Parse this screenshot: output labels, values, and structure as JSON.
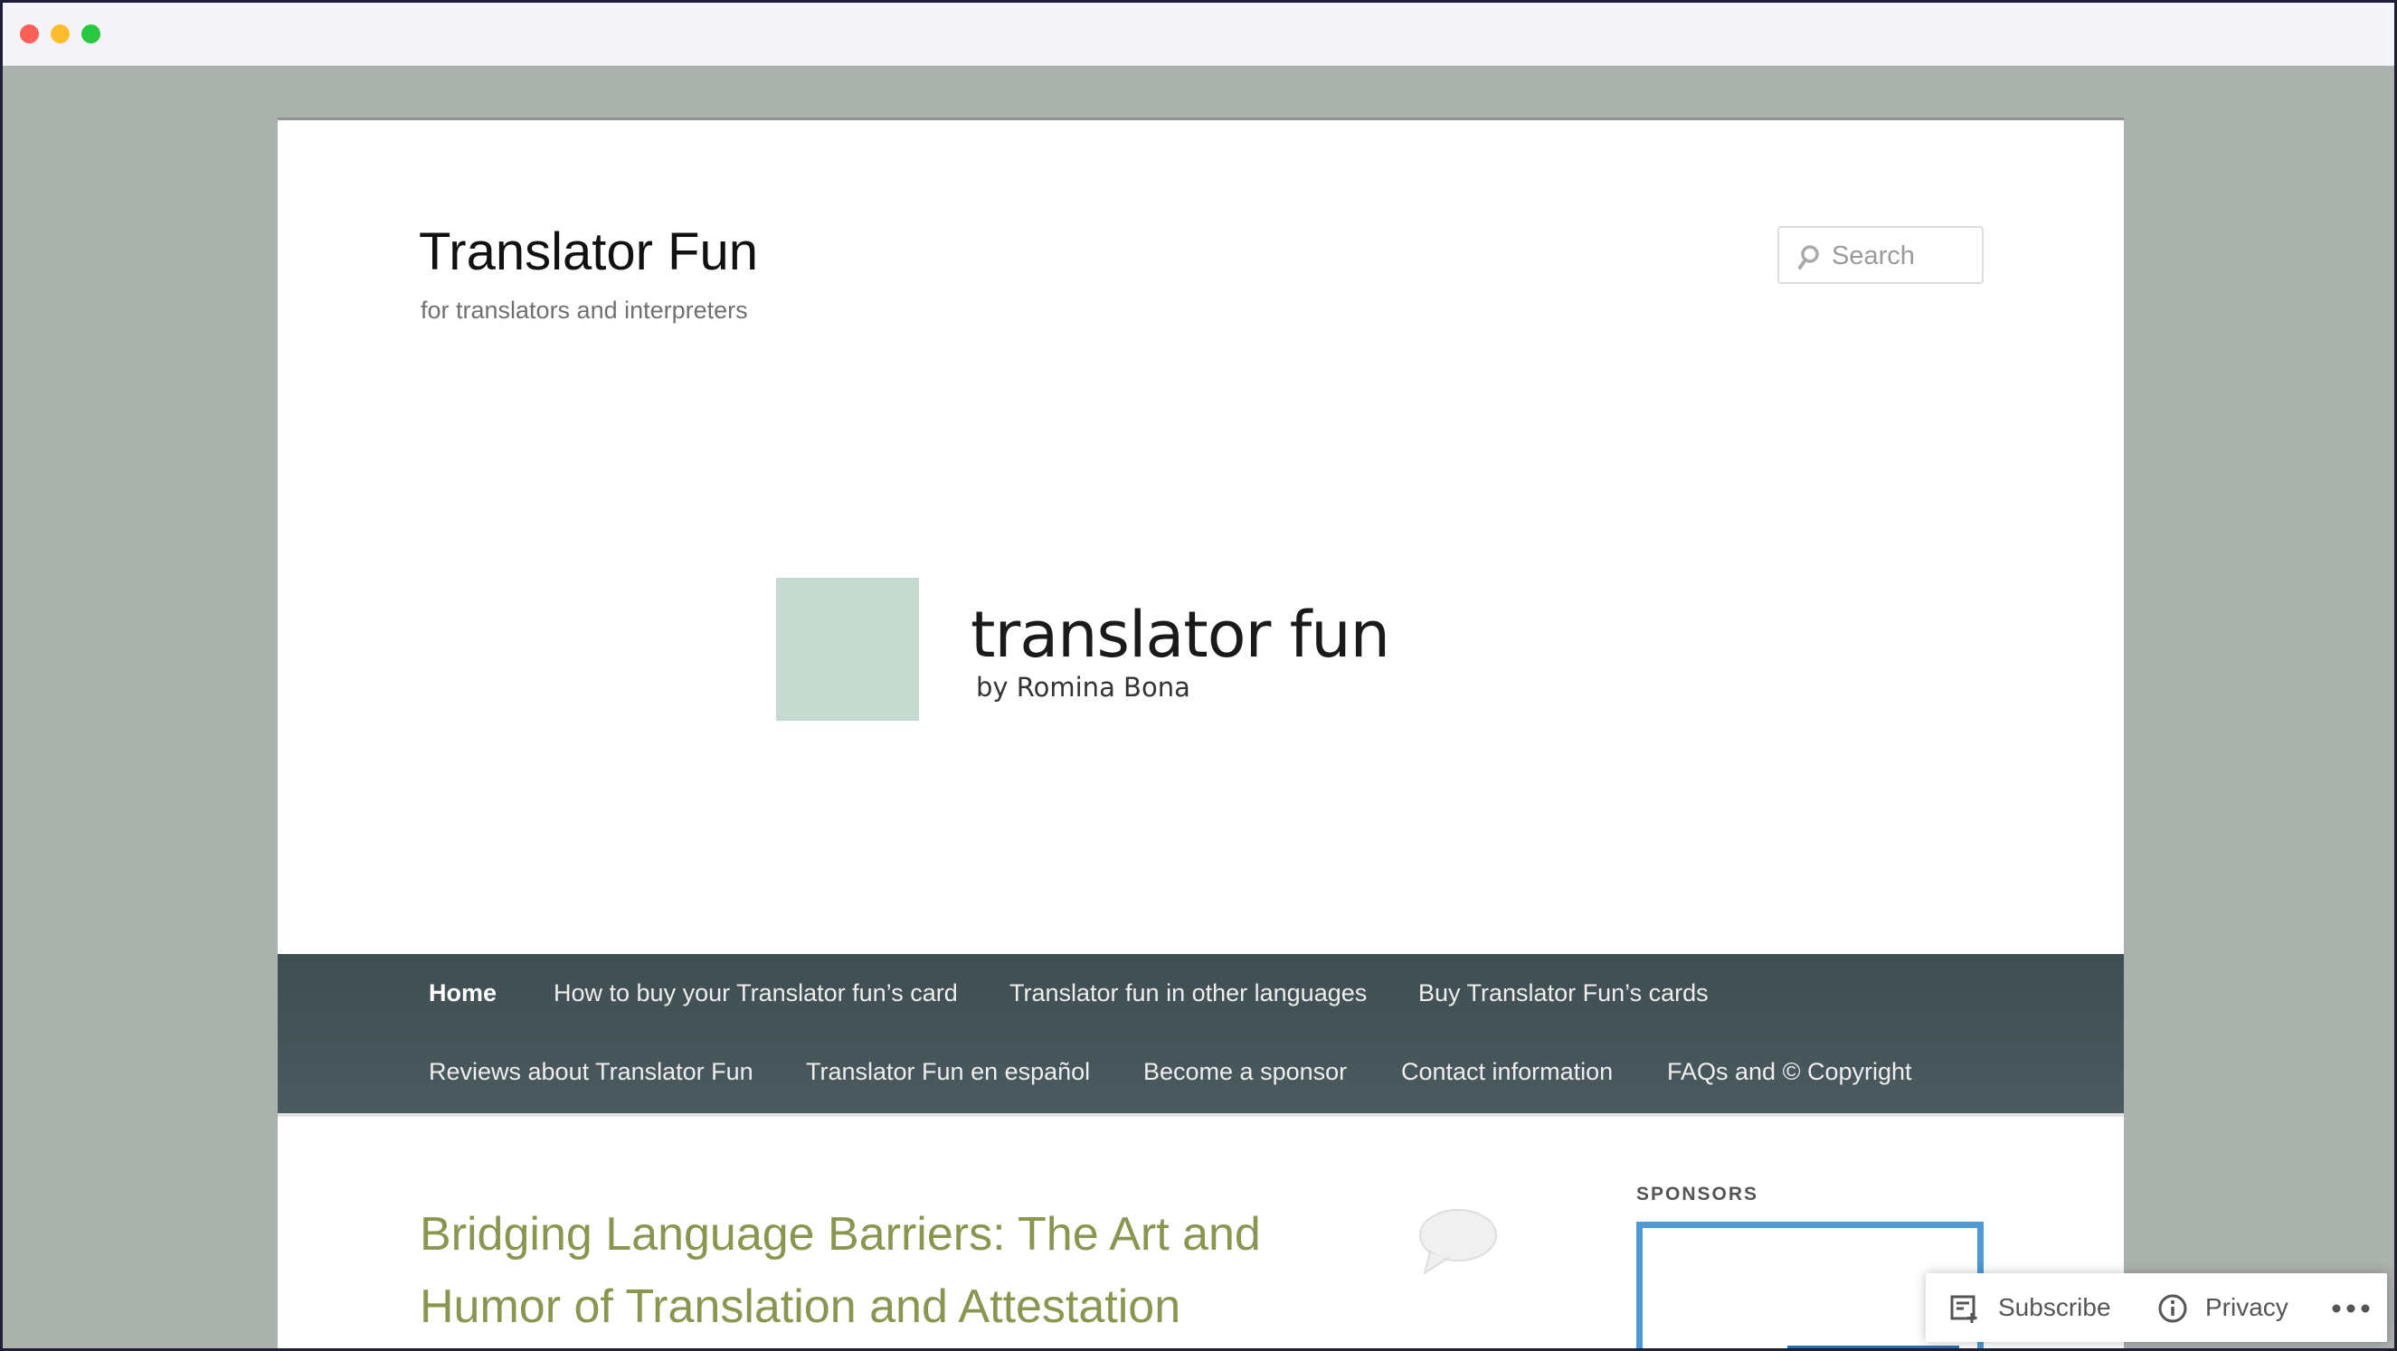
{
  "site": {
    "title": "Translator Fun",
    "description": "for translators and interpreters"
  },
  "search": {
    "placeholder": "Search"
  },
  "logo": {
    "main_text": "translator fun",
    "sub_text": "by Romina Bona"
  },
  "nav": {
    "items": [
      {
        "label": "Home"
      },
      {
        "label": "How to buy your Translator fun’s card"
      },
      {
        "label": "Translator fun in other languages"
      },
      {
        "label": "Buy Translator Fun’s cards"
      },
      {
        "label": "Reviews about Translator Fun"
      },
      {
        "label": "Translator Fun en español"
      },
      {
        "label": "Become a sponsor"
      },
      {
        "label": "Contact information"
      },
      {
        "label": "FAQs and © Copyright"
      }
    ]
  },
  "post": {
    "title": "Bridging Language Barriers: The Art and Humor of Translation and Attestation"
  },
  "sidebar": {
    "sponsors_heading": "SPONSORS"
  },
  "action_bar": {
    "subscribe_label": "Subscribe",
    "privacy_label": "Privacy"
  },
  "colors": {
    "nav_background": "#435356",
    "post_title": "#8a9550",
    "sponsor_border": "#4d9ad6",
    "logo_square": "#c5d9d0"
  }
}
